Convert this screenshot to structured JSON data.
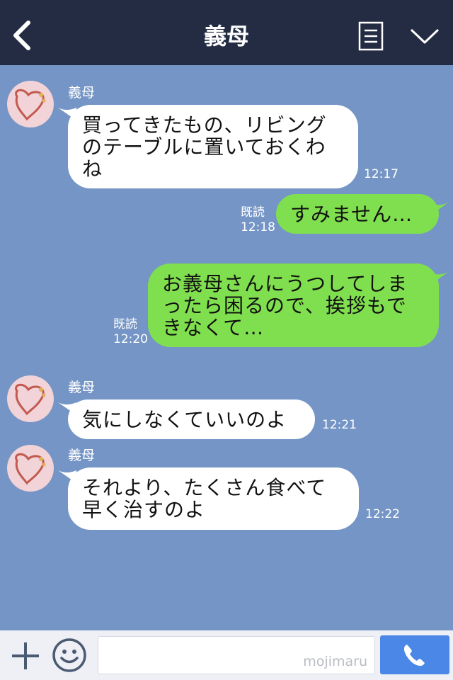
{
  "header": {
    "title": "義母"
  },
  "messages": [
    {
      "sender": "義母",
      "text": "買ってきたもの、リビング\nのテーブルに置いておくわ\nね",
      "time": "12:17"
    },
    {
      "text": "すみません…",
      "read": "既読",
      "time": "12:18"
    },
    {
      "text": "お義母さんにうつしてしま\nったら困るので、挨拶もで\nきなくて…",
      "read": "既読",
      "time": "12:20"
    },
    {
      "sender": "義母",
      "text": "気にしなくていいのよ",
      "time": "12:21"
    },
    {
      "sender": "義母",
      "text": "それより、たくさん食べて\n早く治すのよ",
      "time": "12:22"
    }
  ],
  "input": {
    "watermark": "mojimaru"
  },
  "colors": {
    "header": "#232c43",
    "chat_bg": "#7495c5",
    "outgoing": "#80df4f",
    "incoming": "#ffffff",
    "send": "#4a87e6"
  },
  "icons": {
    "back": "chevron-left-icon",
    "menu": "document-icon",
    "more": "chevron-down-icon",
    "add": "plus-icon",
    "sticker": "smile-icon",
    "send": "phone-icon"
  }
}
